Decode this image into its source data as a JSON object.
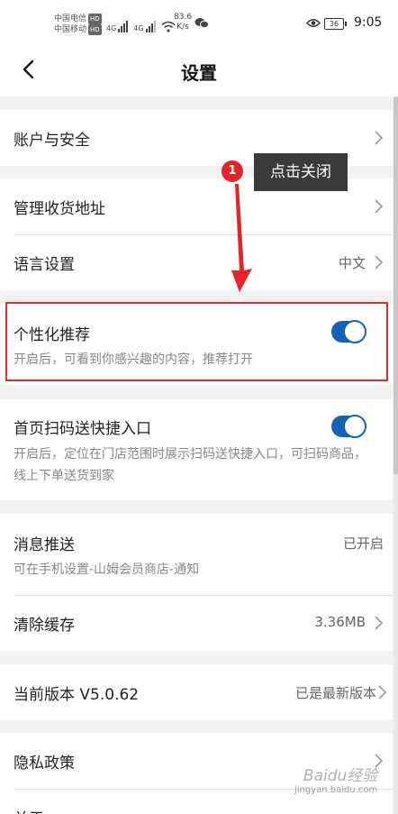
{
  "status_bar": {
    "carrier_1": "中国电信",
    "carrier_2": "中国移动",
    "hd_badge": "HD",
    "network_1": "4G",
    "network_2": "4G",
    "speed_value": "83.6",
    "speed_unit": "K/s",
    "battery": "36",
    "time": "9:05"
  },
  "header": {
    "title": "设置"
  },
  "settings": {
    "account": {
      "label": "账户与安全"
    },
    "address": {
      "label": "管理收货地址"
    },
    "language": {
      "label": "语言设置",
      "value": "中文"
    },
    "personalized": {
      "label": "个性化推荐",
      "description": "开启后，可看到你感兴趣的内容，推荐打开",
      "enabled": true
    },
    "scan_shortcut": {
      "label": "首页扫码送快捷入口",
      "description": "开启后，定位在门店范围时展示扫码送快捷入口，可扫码商品，线上下单送货到家",
      "enabled": true
    },
    "push": {
      "label": "消息推送",
      "value": "已开启",
      "description": "可在手机设置-山姆会员商店-通知"
    },
    "cache": {
      "label": "清除缓存",
      "value": "3.36MB"
    },
    "version": {
      "label": "当前版本 V5.0.62",
      "value": "已是最新版本"
    },
    "privacy": {
      "label": "隐私政策"
    },
    "about": {
      "label": "关于"
    }
  },
  "annotation": {
    "step_number": "1",
    "callout_text": "点击关闭",
    "color": "#e0262a"
  },
  "watermark": {
    "main": "Baidu经验",
    "sub": "jingyan.baidu.com"
  },
  "colors": {
    "accent": "#1464b4",
    "background": "#f2f2f2",
    "annotation": "#e0262a"
  }
}
